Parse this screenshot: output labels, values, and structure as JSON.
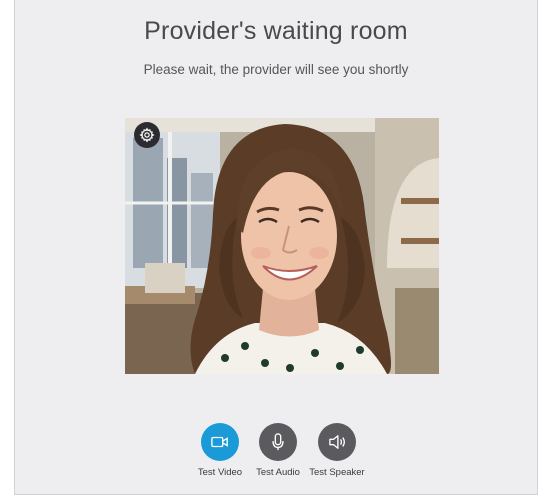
{
  "page": {
    "title": "Provider's waiting room",
    "subtitle": "Please wait, the provider will see you shortly"
  },
  "video": {
    "settings_icon": "gear-icon"
  },
  "controls": [
    {
      "label": "Test Video",
      "icon": "video-camera-icon",
      "color": "#1a9bd7",
      "active": true
    },
    {
      "label": "Test Audio",
      "icon": "microphone-icon",
      "color": "#5b5b5f",
      "active": false
    },
    {
      "label": "Test Speaker",
      "icon": "speaker-icon",
      "color": "#5b5b5f",
      "active": false
    }
  ],
  "colors": {
    "background": "#eeeef0",
    "accent": "#1a9bd7",
    "control_inactive": "#5b5b5f"
  }
}
